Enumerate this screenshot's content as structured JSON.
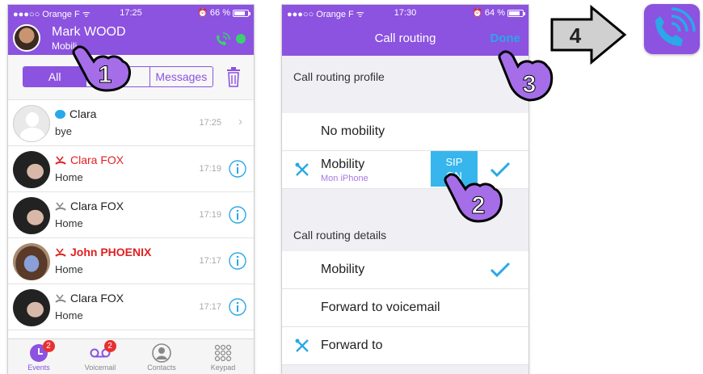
{
  "phone1": {
    "status": {
      "carrier": "Orange F",
      "time": "17:25",
      "battery": "66 %"
    },
    "header": {
      "name": "Mark WOOD",
      "subtitle": "Mobili"
    },
    "filter": {
      "tabs": [
        "All",
        "ed",
        "Messages"
      ],
      "active_index": 0
    },
    "events": [
      {
        "name": "Clara",
        "sub": "bye",
        "time": "17:25",
        "kind": "message",
        "missed": false
      },
      {
        "name": "Clara FOX",
        "sub": "Home",
        "time": "17:19",
        "kind": "missed-call",
        "missed": true
      },
      {
        "name": "Clara FOX",
        "sub": "Home",
        "time": "17:19",
        "kind": "call",
        "missed": false
      },
      {
        "name": "John PHOENIX",
        "sub": "Home",
        "time": "17:17",
        "kind": "missed-call",
        "missed": true
      },
      {
        "name": "Clara FOX",
        "sub": "Home",
        "time": "17:17",
        "kind": "call",
        "missed": false
      }
    ],
    "tabbar": [
      {
        "label": "Events",
        "badge": "2",
        "active": true
      },
      {
        "label": "Voicemail",
        "badge": "2",
        "active": false
      },
      {
        "label": "Contacts",
        "badge": "",
        "active": false
      },
      {
        "label": "Keypad",
        "badge": "",
        "active": false
      }
    ]
  },
  "phone2": {
    "status": {
      "carrier": "Orange F",
      "time": "17:30",
      "battery": "64 %"
    },
    "header": {
      "title": "Call routing",
      "done": "Done"
    },
    "profile_section": "Call routing profile",
    "profile": {
      "no_mobility": "No mobility",
      "mobility": "Mobility",
      "mobility_sub": "Mon iPhone",
      "sip_line1": "SIP",
      "sip_line2": "ON"
    },
    "details_section": "Call routing details",
    "details": {
      "mobility": "Mobility",
      "voicemail": "Forward to voicemail",
      "forward": "Forward to"
    }
  },
  "steps": {
    "one": "1",
    "two": "2",
    "three": "3",
    "four": "4"
  },
  "colors": {
    "purple": "#8c52e0",
    "blue": "#2aa8e8",
    "missed": "#e02020"
  }
}
